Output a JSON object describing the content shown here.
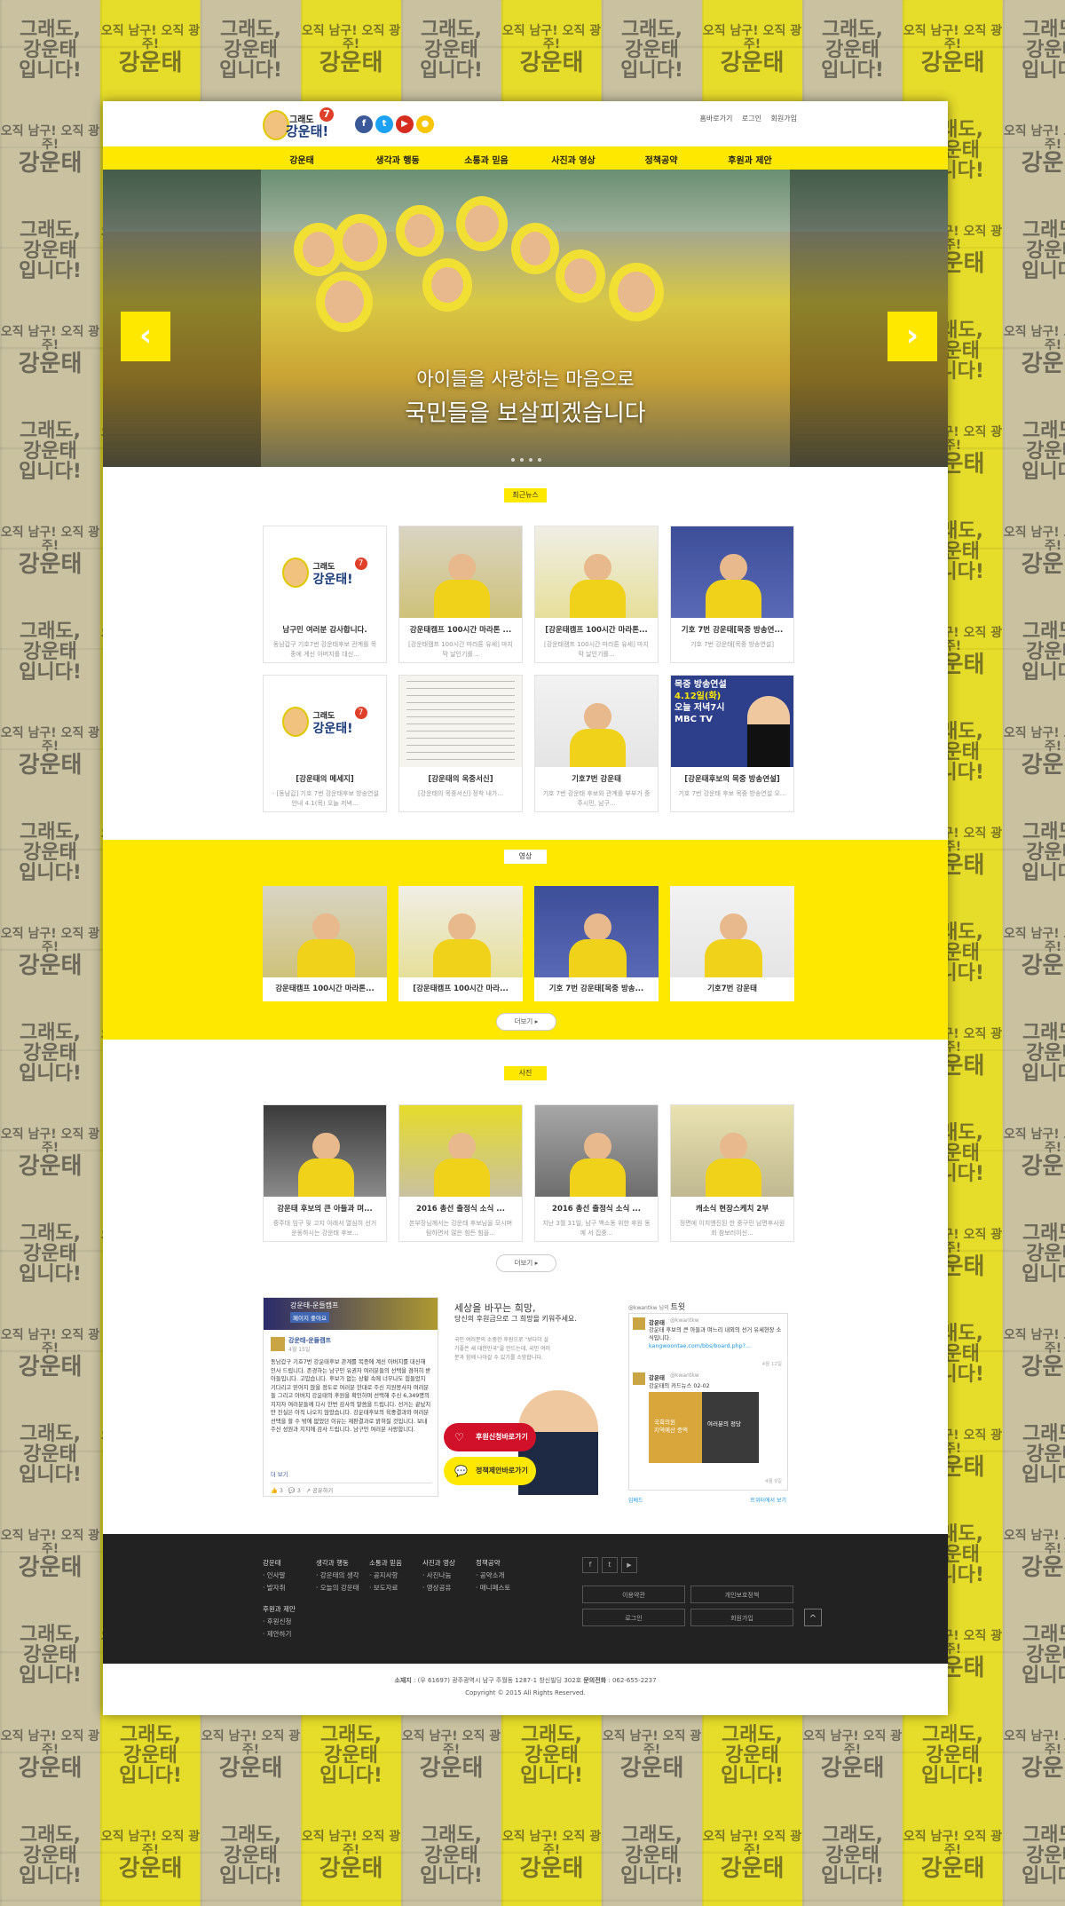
{
  "background_slogan": {
    "line1": "그래도,",
    "line2": "강운태",
    "line3": "입니다!",
    "alt_top": "오직 남구! 오직 광주!",
    "alt_main": "강운태"
  },
  "header": {
    "logo": {
      "line1": "그래도",
      "line2": "강운태!",
      "badge": "7"
    },
    "sns": [
      {
        "name": "facebook",
        "glyph": "f",
        "color": "#3b5998"
      },
      {
        "name": "twitter",
        "glyph": "t",
        "color": "#1da1f2"
      },
      {
        "name": "youtube",
        "glyph": "▶",
        "color": "#d62d20"
      },
      {
        "name": "kakao",
        "glyph": "●",
        "color": "#f7c600"
      }
    ],
    "top_links": [
      "홈바로가기",
      "로그인",
      "회원가입"
    ]
  },
  "nav": [
    "강운태",
    "생각과 행동",
    "소통과 믿음",
    "사진과 영상",
    "정책공약",
    "후원과 제안"
  ],
  "hero": {
    "caption_line1": "아이들을 사랑하는 마음으로",
    "caption_line2": "국민들을 보살피겠습니다",
    "prev": "‹",
    "next": "›"
  },
  "news": {
    "badge": "최근뉴스",
    "items": [
      {
        "title": "남구민 여러분 감사합니다.",
        "desc": "동남갑구 기호7번 강운태후보 관계를 목종에 게신 아버지를 대신..."
      },
      {
        "title": "강운태캠프 100시간 마라톤 ...",
        "desc": "[강운태캠프 100시간 마라톤 유세] 마지막 날인기를..."
      },
      {
        "title": "[강운태캠프 100시간 마라톤...",
        "desc": "[강운태캠프 100시간 마라톤 유세] 마지막 날인기를..."
      },
      {
        "title": "기호 7번 강운태[목중 방송연...",
        "desc": "기호 7번 강운태[목중 방송연설]"
      },
      {
        "title": "[강운태의 메세지]",
        "desc": "ㆍ[동남갑] 기호 7번 강운태후보 방송연설안내 4.1(목) 오늘 저녁..."
      },
      {
        "title": "[강운태의 옥중서신]",
        "desc": "[강운태의 목중서신] 정착 내가..."
      },
      {
        "title": "기호7번 강운태",
        "desc": "기호 7번 강운태 후보와 관계를 부부가 중주시민, 남구..."
      },
      {
        "title": "[강운태후보의 목중 방송연설]",
        "desc": "기호 7번 강운태 후보 목중 방송연설 오..."
      }
    ],
    "poster": {
      "l1": "목중 방송연설",
      "l2": "4.12일(화)",
      "l3": "오늘 저녁7시",
      "l4": "MBC TV"
    }
  },
  "video": {
    "badge": "영상",
    "items": [
      "강운태캠프 100시간 마라톤...",
      "[강운태캠프 100시간 마라...",
      "기호 7번 강운태[목중 방송...",
      "기호7번 강운태"
    ],
    "more": "더보기 ▸"
  },
  "photos": {
    "badge": "사진",
    "items": [
      {
        "title": "강운태 후보의 큰 아들과 며...",
        "desc": "중주대 임구 및 고지 아래서 열심히 선거운동하시는 강운태 후보..."
      },
      {
        "title": "2016 총선 출정식 소식 ...",
        "desc": "본부장님께서는 강운태 후보님을 모시며 탐하면서 많은 힘든 힘을..."
      },
      {
        "title": "2016 총선 출정식 소식 ...",
        "desc": "지난 3월 31일, 남구 백소동 위한 후원 동께 서 집중..."
      },
      {
        "title": "캐소식 현장스케치 2부",
        "desc": "정면에 이치엔진된 한 중구민 남편후사원 회 참보러이신..."
      }
    ],
    "more": "더보기 ▸"
  },
  "facebook": {
    "page_name": "강운태-운들캠프",
    "like_label": "페이지 좋아요",
    "post_author": "강운태-운들캠프",
    "post_date": "4월 15일",
    "post_body": "동남갑구 기호7번 강운태후보 관계를 목종에 계신 아버지를 대신해 인사 드립니다. 존경하는 남구민 유권자 여러분들의 선택을 겸허히 받아들입니다. 고맙습니다. 후보가 없는 상황 속에 너무나도 힘들었지 기다리고 믿어지 않을 정도로 여러분 한대로 주신 지원봉사자 여러분들 그리고 아버지 강운태의 후원을 확인하며 선택해 주신 6,349명의 지지자 여러분들께 다시 한번 감사의 말씀을 드립니다. 선거는 끝났지만 진실은 아직 나오지 않았습니다. 강운태후보의 육중결과와 여러분 선택을 할 수 밖에 없었던 이유는 재판결과로 밝혀질 것입니다. 보내주신 성원과 지지에 감사 드립니다. 남구민 여러분 사랑합니다.",
    "see_more": "더 보기",
    "likes": "3",
    "comments": "3",
    "share": "공유하기"
  },
  "support": {
    "headline1": "세상을 바꾸는 희망,",
    "headline2": "당신의 후원금으로 그 희망을 키워주세요.",
    "body": "국민 여러분의 소중한 후원으로 \"보다더 살기좋은 새 대한민국\"을 만드는데, 국민 여러분과 함께 나아갈 수 있기를 소망합니다.",
    "btn_donate": "후원신청바로가기",
    "btn_policy": "정책제안바로가기"
  },
  "twitter": {
    "header_handle": "@kwantkw 님의",
    "header_label": "트윗",
    "tweets": [
      {
        "author": "강운태",
        "handle": "@kwantkw",
        "text": "강운태 후보의 큰 아들과 며느리 내외의 선거 유세현장 소식입니다.",
        "link": "kangwoontae.com/bbs/board.php?...",
        "time": "4월 12일"
      },
      {
        "author": "강운태",
        "handle": "@kwantkw",
        "text": "강운태의 카드뉴스 02-02",
        "time": "4월 9일"
      }
    ],
    "card_l1": "국회의원",
    "card_l2": "지역예산 증액",
    "card_l3": "여러분의 정당",
    "embed": "임베드",
    "view_on_twitter": "트위터에서 보기"
  },
  "footer": {
    "columns": [
      {
        "head": "강운태",
        "items": [
          "인사말",
          "발자취"
        ]
      },
      {
        "head": "생각과 행동",
        "items": [
          "강운태의 생각",
          "오늘의 강운태"
        ]
      },
      {
        "head": "소통과 믿음",
        "items": [
          "공지사항",
          "보도자료"
        ]
      },
      {
        "head": "사진과 영상",
        "items": [
          "사진나눔",
          "영상공유"
        ]
      },
      {
        "head": "정책공약",
        "items": [
          "공약소개",
          "매니페스토"
        ]
      }
    ],
    "col6": {
      "head": "후원과 제안",
      "items": [
        "후원신청",
        "제안하기"
      ]
    },
    "buttons": [
      "이용약관",
      "개인보호정책",
      "로그인",
      "회원가입"
    ],
    "top": "^"
  },
  "bottom": {
    "address_label": "소재지",
    "address": ": (우 61697) 광주광역시 남구 주월동 1287-1 창신빌딩 302호",
    "phone_label": "문의전화",
    "phone": ": 062-655-2237",
    "copyright": "Copyright © 2015 All Rights Reserved."
  }
}
